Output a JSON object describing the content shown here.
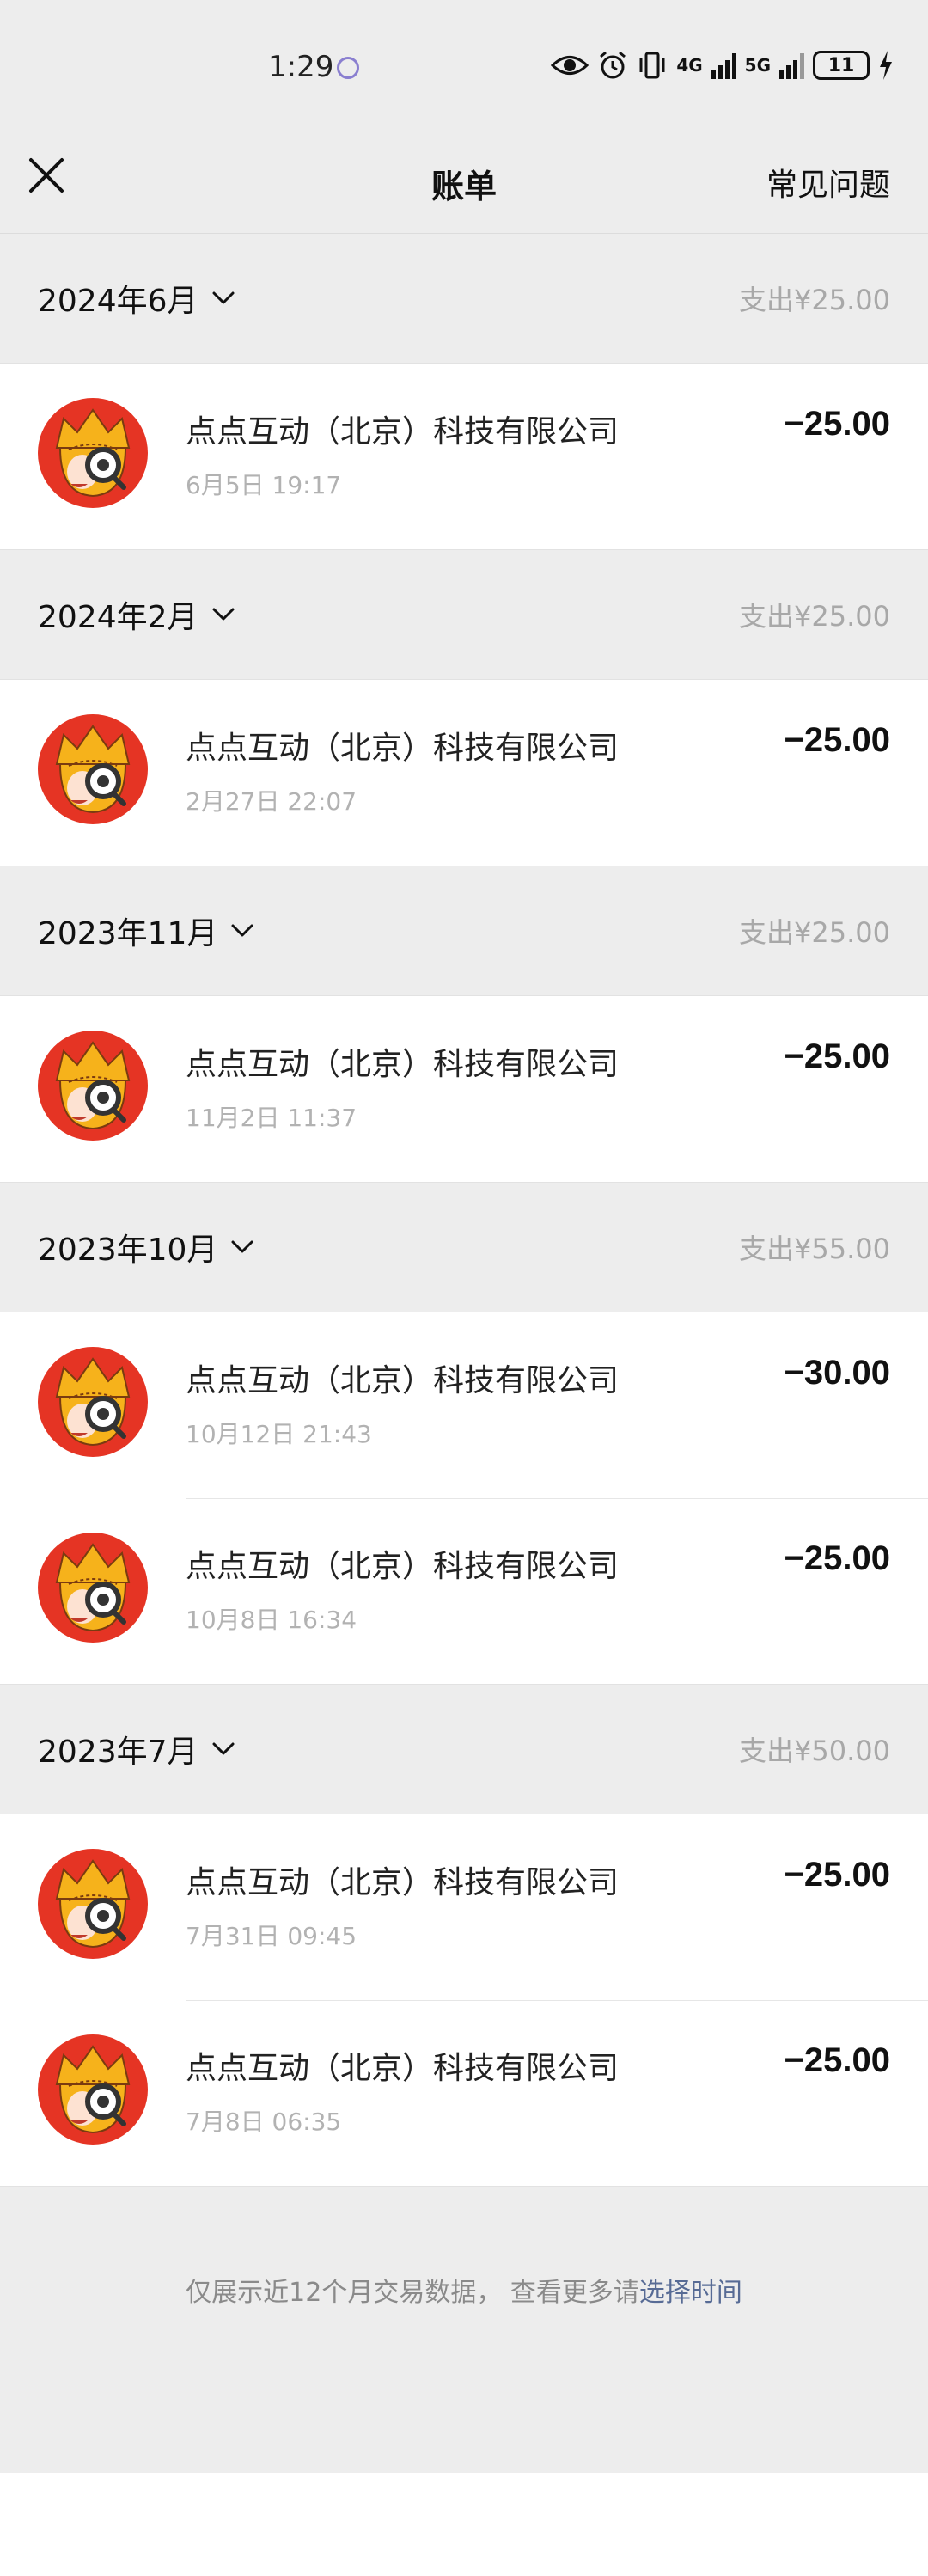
{
  "status_bar": {
    "time": "1:29",
    "network_4g": "4G",
    "network_5g": "5G",
    "battery": "11"
  },
  "nav": {
    "title": "账单",
    "faq_label": "常见问题"
  },
  "months": [
    {
      "label": "2024年6月",
      "total": "支出¥25.00",
      "transactions": [
        {
          "merchant": "点点互动（北京）科技有限公司",
          "time": "6月5日 19:17",
          "amount": "−25.00"
        }
      ]
    },
    {
      "label": "2024年2月",
      "total": "支出¥25.00",
      "transactions": [
        {
          "merchant": "点点互动（北京）科技有限公司",
          "time": "2月27日 22:07",
          "amount": "−25.00"
        }
      ]
    },
    {
      "label": "2023年11月",
      "total": "支出¥25.00",
      "transactions": [
        {
          "merchant": "点点互动（北京）科技有限公司",
          "time": "11月2日 11:37",
          "amount": "−25.00"
        }
      ]
    },
    {
      "label": "2023年10月",
      "total": "支出¥55.00",
      "transactions": [
        {
          "merchant": "点点互动（北京）科技有限公司",
          "time": "10月12日 21:43",
          "amount": "−30.00"
        },
        {
          "merchant": "点点互动（北京）科技有限公司",
          "time": "10月8日 16:34",
          "amount": "−25.00"
        }
      ]
    },
    {
      "label": "2023年7月",
      "total": "支出¥50.00",
      "transactions": [
        {
          "merchant": "点点互动（北京）科技有限公司",
          "time": "7月31日 09:45",
          "amount": "−25.00"
        },
        {
          "merchant": "点点互动（北京）科技有限公司",
          "time": "7月8日 06:35",
          "amount": "−25.00"
        }
      ]
    }
  ],
  "footer": {
    "text": "仅展示近12个月交易数据， 查看更多请",
    "link": "选择时间"
  },
  "colors": {
    "background": "#ededed",
    "link": "#576b95",
    "muted": "#a8a8a8",
    "avatar_red": "#e53424",
    "avatar_yellow": "#f6b21b"
  }
}
